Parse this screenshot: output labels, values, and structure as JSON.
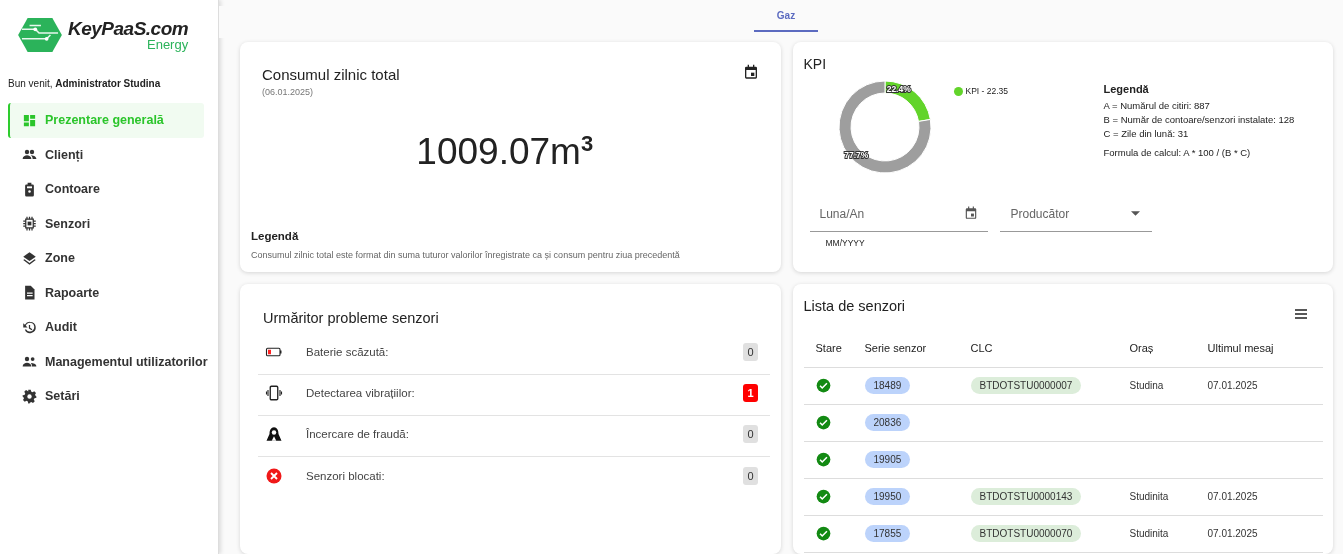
{
  "sidebar": {
    "logo": {
      "name": "KeyPaaS.com",
      "tagline": "Energy"
    },
    "welcome": "Bun venit, **Administrator Studina**",
    "items": [
      {
        "label": "Prezentare generală",
        "selected": true
      },
      {
        "label": "Clienți",
        "selected": false
      },
      {
        "label": "Contoare",
        "selected": false
      },
      {
        "label": "Senzori",
        "selected": false
      },
      {
        "label": "Zone",
        "selected": false
      },
      {
        "label": "Rapoarte",
        "selected": false
      },
      {
        "label": "Audit",
        "selected": false
      },
      {
        "label": "Managementul utilizatorilor",
        "selected": false
      },
      {
        "label": "Setări",
        "selected": false
      }
    ]
  },
  "tabs": [
    {
      "label": "Gaz",
      "selected": true
    }
  ],
  "daily_consumption": {
    "title": "Consumul zilnic total",
    "date": "(06.01.2025)",
    "value": "1009.07m$^{3}$",
    "legend_title": "Legendă",
    "legend_text": "Consumul zilnic total este format din suma tuturor valorilor înregistrate ca și consum pentru ziua precedentă"
  },
  "kpi": {
    "title": "KPI",
    "chart_data": {
      "type": "donut",
      "values": [
        22.4,
        77.7
      ],
      "colors": [
        "#62d42a",
        "#9e9e9e"
      ],
      "value_labels": [
        "22.4%",
        "77.7%"
      ]
    },
    "legend_label": "KPI - 22.35",
    "legend_title": "Legendă",
    "legend_lines": [
      "A = Numărul de citiri: 887",
      "B = Număr de contoare/senzori instalate: 128",
      "C = Zile din lună: 31"
    ],
    "formula": "Formula de calcul: A * 100 / (B * C)",
    "month_field": {
      "placeholder": "Luna/An",
      "helper": "MM/YYYY"
    },
    "producer_field": {
      "placeholder": "Producător"
    }
  },
  "problems": {
    "title": "Urmăritor probleme senzori",
    "rows": [
      {
        "kind": "battery",
        "label": "Baterie scăzută:",
        "count": "0",
        "alert": false
      },
      {
        "kind": "vibration",
        "label": "Detectarea vibrațiilor:",
        "count": "1",
        "alert": true
      },
      {
        "kind": "fraud",
        "label": "Încercare de fraudă:",
        "count": "0",
        "alert": false
      },
      {
        "kind": "blocked",
        "label": "Senzori blocati:",
        "count": "0",
        "alert": false
      }
    ]
  },
  "sensors": {
    "title": "Lista de senzori",
    "columns": [
      "Stare",
      "Serie senzor",
      "CLC",
      "Oraș",
      "Ultimul mesaj"
    ],
    "rows": [
      {
        "active": true,
        "serial": "18489",
        "clc": "BTDOTSTU0000007",
        "city": "Studina",
        "last_message": "07.01.2025"
      },
      {
        "active": true,
        "serial": "20836"
      },
      {
        "active": true,
        "serial": "19905"
      },
      {
        "active": true,
        "serial": "19950",
        "clc": "BTDOTSTU0000143",
        "city": "Studinita",
        "last_message": "07.01.2025"
      },
      {
        "active": true,
        "serial": "17855",
        "clc": "BTDOTSTU0000070",
        "city": "Studinita",
        "last_message": "07.01.2025"
      }
    ]
  }
}
